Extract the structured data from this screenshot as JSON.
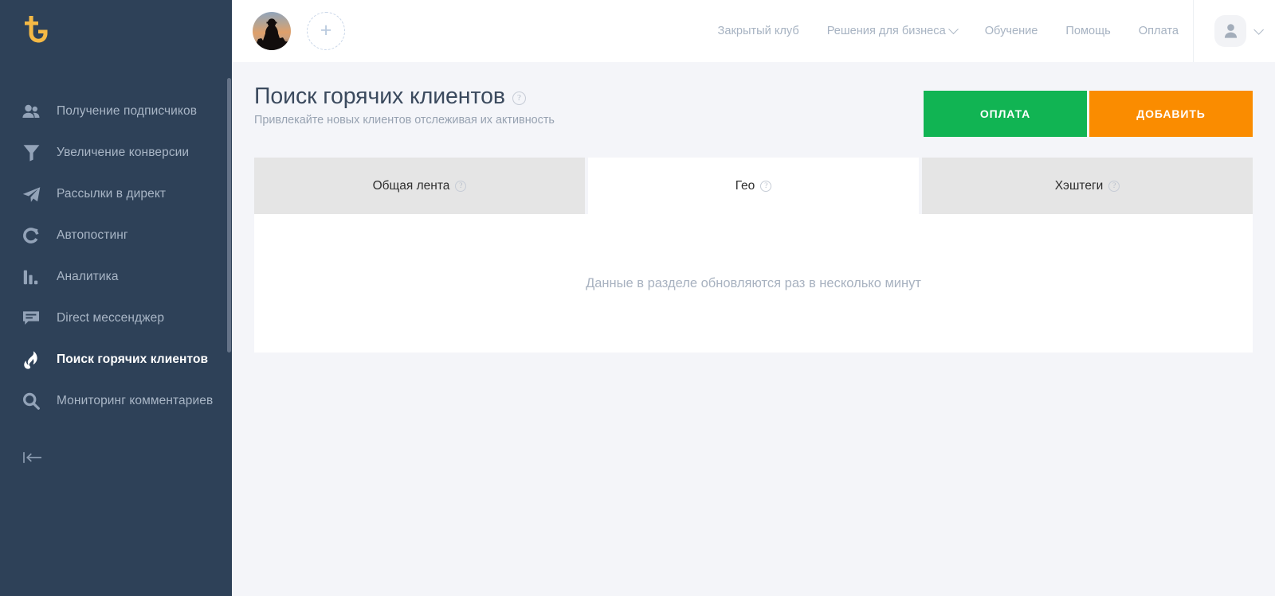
{
  "brand": {
    "logo_icon": "tg-monogram-logo",
    "logo_color": "#f5b945",
    "sidebar_bg": "#2e4158"
  },
  "sidebar": {
    "items": [
      {
        "label": "Получение подписчиков",
        "icon": "users-icon",
        "active": false
      },
      {
        "label": "Увеличение конверсии",
        "icon": "funnel-icon",
        "active": false
      },
      {
        "label": "Рассылки в директ",
        "icon": "paper-plane-icon",
        "active": false
      },
      {
        "label": "Автопостинг",
        "icon": "refresh-icon",
        "active": false
      },
      {
        "label": "Аналитика",
        "icon": "bar-chart-icon",
        "active": false
      },
      {
        "label": "Direct мессенджер",
        "icon": "chat-bubble-icon",
        "active": false
      },
      {
        "label": "Поиск горячих клиентов",
        "icon": "flame-icon",
        "active": true
      },
      {
        "label": "Мониторинг комментариев",
        "icon": "magnifier-icon",
        "active": false
      }
    ],
    "collapse_icon": "collapse-left-icon"
  },
  "topbar": {
    "accounts": {
      "avatar_icon": "account-avatar",
      "add_icon": "plus-icon"
    },
    "nav": [
      {
        "label": "Закрытый клуб",
        "has_caret": false
      },
      {
        "label": "Решения для бизнеса",
        "has_caret": true
      },
      {
        "label": "Обучение",
        "has_caret": false
      },
      {
        "label": "Помощь",
        "has_caret": false
      },
      {
        "label": "Оплата",
        "has_caret": false
      }
    ],
    "profile": {
      "icon": "user-profile-icon",
      "caret_icon": "chevron-down-icon"
    }
  },
  "page": {
    "title": "Поиск горячих клиентов",
    "title_help_icon": "question-mark-icon",
    "subtitle": "Привлекайте новых клиентов отслеживая их активность",
    "buttons": {
      "pay": {
        "label": "ОПЛАТА",
        "color": "#11b453"
      },
      "add": {
        "label": "ДОБАВИТЬ",
        "color": "#fa8c00"
      }
    }
  },
  "tabs": [
    {
      "label": "Общая лента",
      "help_icon": "question-mark-icon",
      "active": false
    },
    {
      "label": "Гео",
      "help_icon": "question-mark-icon",
      "active": true
    },
    {
      "label": "Хэштеги",
      "help_icon": "question-mark-icon",
      "active": false
    }
  ],
  "content": {
    "empty_message": "Данные в разделе обновляются раз в несколько минут"
  }
}
